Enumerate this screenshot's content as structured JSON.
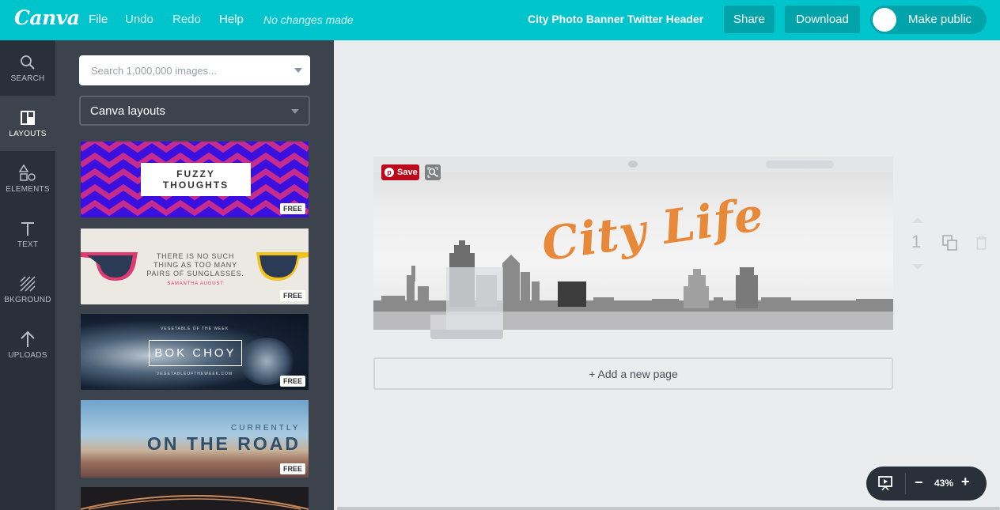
{
  "topbar": {
    "logo": "Canva",
    "menu": {
      "file": "File",
      "undo": "Undo",
      "redo": "Redo",
      "help": "Help"
    },
    "status": "No changes made",
    "document_title": "City Photo Banner Twitter Header",
    "share_label": "Share",
    "download_label": "Download",
    "make_public_label": "Make public"
  },
  "iconbar": {
    "items": [
      {
        "label": "SEARCH",
        "icon": "magnifier-icon"
      },
      {
        "label": "LAYOUTS",
        "icon": "layouts-icon",
        "active": true
      },
      {
        "label": "ELEMENTS",
        "icon": "shapes-icon"
      },
      {
        "label": "TEXT",
        "icon": "text-t-icon"
      },
      {
        "label": "BKGROUND",
        "icon": "hatch-pattern-icon"
      },
      {
        "label": "UPLOADS",
        "icon": "upload-arrow-icon"
      }
    ]
  },
  "panel": {
    "search_placeholder": "Search 1,000,000 images...",
    "layout_select": "Canva layouts",
    "thumbnails": [
      {
        "line1": "FUZZY",
        "line2": "THOUGHTS",
        "badge": "FREE"
      },
      {
        "line1": "THERE IS NO SUCH",
        "line2": "THING AS TOO MANY",
        "line3": "PAIRS OF SUNGLASSES.",
        "author": "SAMANTHA AUGUST",
        "badge": "FREE"
      },
      {
        "kicker": "VEGETABLE OF THE WEEK",
        "title": "BOK CHOY",
        "url": "VEGETABLEOFTHEWEEK.COM",
        "badge": "FREE"
      },
      {
        "kicker": "CURRENTLY",
        "title": "ON THE ROAD",
        "badge": "FREE"
      }
    ]
  },
  "canvas": {
    "save_label": "Save",
    "headline": "City Life",
    "add_page_label": "+ Add a new page",
    "page_number": "1"
  },
  "zoom": {
    "level": "43%"
  },
  "colors": {
    "brand": "#00c4cc",
    "brand_dark": "#00a3aa",
    "sidebar": "#293039",
    "panel": "#3c434c",
    "headline": "#e8893a",
    "pinterest": "#bd081c"
  }
}
